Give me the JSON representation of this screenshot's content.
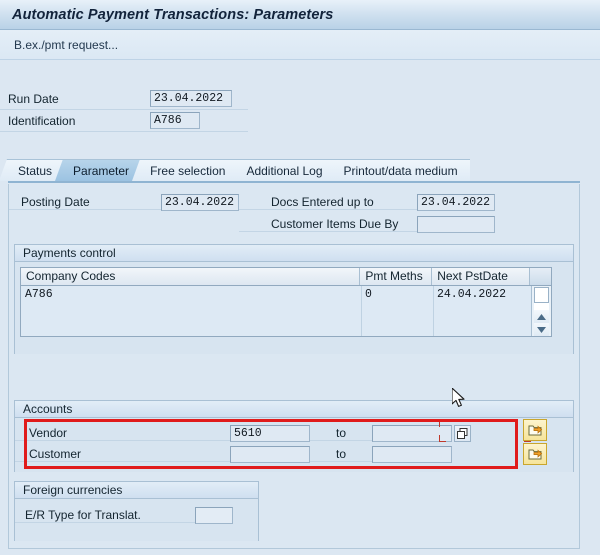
{
  "window": {
    "title": "Automatic Payment Transactions: Parameters",
    "toolbar_text": "B.ex./pmt request..."
  },
  "header_form": {
    "run_date_label": "Run Date",
    "run_date_value": "23.04.2022",
    "identification_label": "Identification",
    "identification_value": "A786"
  },
  "tabs": [
    {
      "label": "Status",
      "active": false
    },
    {
      "label": "Parameter",
      "active": true
    },
    {
      "label": "Free selection",
      "active": false
    },
    {
      "label": "Additional Log",
      "active": false
    },
    {
      "label": "Printout/data medium",
      "active": false
    }
  ],
  "parameter_tab": {
    "posting_date_label": "Posting Date",
    "posting_date_value": "23.04.2022",
    "docs_entered_label": "Docs Entered up to",
    "docs_entered_value": "23.04.2022",
    "customer_items_label": "Customer Items Due By",
    "customer_items_value": ""
  },
  "payments_control": {
    "title": "Payments control",
    "columns": [
      "Company Codes",
      "Pmt Meths",
      "Next PstDate"
    ],
    "rows": [
      {
        "company_code": "A786",
        "pmt_meths": "0",
        "next_pst_date": "24.04.2022"
      }
    ]
  },
  "accounts": {
    "title": "Accounts",
    "rows": [
      {
        "label": "Vendor",
        "from": "5610",
        "to_label": "to",
        "to": ""
      },
      {
        "label": "Customer",
        "from": "",
        "to_label": "to",
        "to": ""
      }
    ]
  },
  "foreign_currencies": {
    "title": "Foreign currencies",
    "er_type_label": "E/R Type for Translat.",
    "er_type_value": ""
  },
  "colors": {
    "title_text": "#12233b",
    "highlight_red": "#e01b1b",
    "accent_blue": "#9cc3e2",
    "button_yellow": "#f6e49a",
    "panel_bg": "#dbe7f2"
  }
}
